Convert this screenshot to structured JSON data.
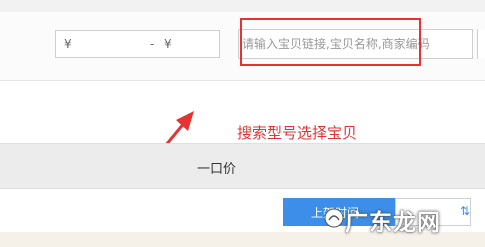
{
  "filter": {
    "price_min_symbol": "¥",
    "price_separator": "-",
    "price_max_symbol": "¥",
    "search_placeholder": "请输入宝贝链接,宝贝名称,商家编码"
  },
  "annotation": {
    "text": "搜索型号选择宝贝",
    "color": "#e53333"
  },
  "table": {
    "column_price": "一口价"
  },
  "sort": {
    "button_label": "上架时间"
  },
  "watermark": {
    "text": "广东龙网"
  },
  "colors": {
    "accent_blue": "#3c8ee8",
    "annotation_red": "#e53333"
  }
}
